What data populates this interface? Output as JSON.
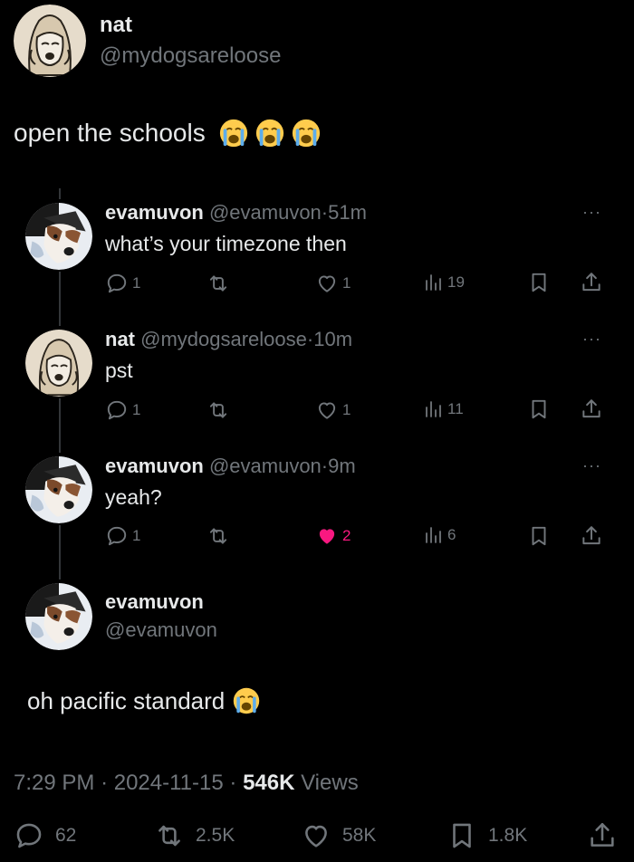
{
  "main_tweet": {
    "display_name": "nat",
    "handle": "@mydogsareloose",
    "text": "open the schools",
    "emoji_count": 3,
    "timestamp": "7:29 PM",
    "date": "2024-11-15",
    "views_count": "546K",
    "views_label": "Views",
    "stats": {
      "replies": "62",
      "reposts": "2.5K",
      "likes": "58K",
      "bookmarks": "1.8K"
    }
  },
  "thread": [
    {
      "display_name": "evamuvon",
      "handle": "@evamuvon",
      "time": "51m",
      "text": "what’s your timezone then",
      "replies": "1",
      "likes": "1",
      "views": "19",
      "liked": false
    },
    {
      "display_name": "nat",
      "handle": "@mydogsareloose",
      "time": "10m",
      "text": "pst",
      "replies": "1",
      "likes": "1",
      "views": "11",
      "liked": false
    },
    {
      "display_name": "evamuvon",
      "handle": "@evamuvon",
      "time": "9m",
      "text": "yeah?",
      "replies": "1",
      "likes": "2",
      "views": "6",
      "liked": true
    }
  ],
  "focused_reply": {
    "display_name": "evamuvon",
    "handle": "@evamuvon",
    "text": "oh pacific standard"
  },
  "separator": "·",
  "more_glyph": "···",
  "colors": {
    "background": "#000000",
    "text": "#e7e9ea",
    "muted": "#71767b",
    "like_active": "#f91880"
  }
}
